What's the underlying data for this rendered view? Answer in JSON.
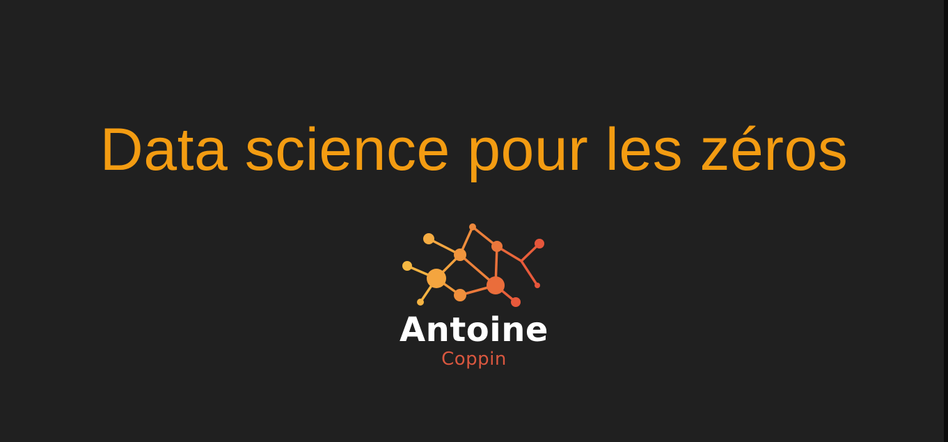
{
  "slide": {
    "title": "Data science pour les zéros",
    "author_first_name": "Antoine",
    "author_last_name": "Coppin"
  },
  "colors": {
    "background": "#202020",
    "title": "#f39c12",
    "brand_name": "#ffffff",
    "brand_sub": "#d9573f",
    "logo_gradient": [
      "#f5b342",
      "#f08a3a",
      "#e8573b"
    ]
  },
  "icons": {
    "logo": "network-nodes-logo"
  }
}
